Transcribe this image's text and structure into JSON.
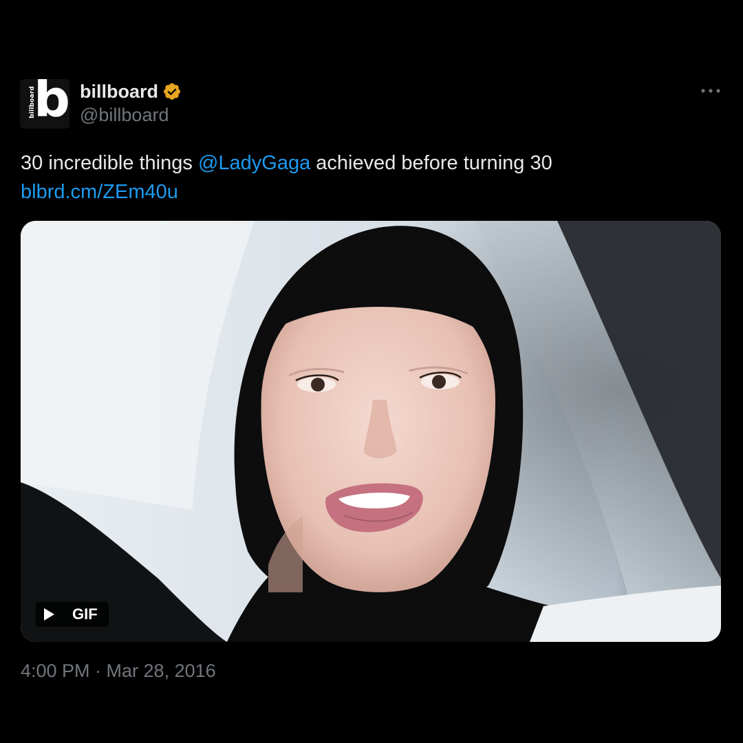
{
  "tweet": {
    "author": {
      "display_name": "billboard",
      "handle": "@billboard",
      "verified": true,
      "avatar_letter": "b",
      "avatar_wordmark": "billboard",
      "verified_color": "#e8a521"
    },
    "more_icon": "more-horizontal-icon",
    "text": {
      "prefix": "30 incredible things ",
      "mention": "@LadyGaga",
      "suffix": " achieved before turning 30",
      "link": "blbrd.cm/ZEm40u"
    },
    "media": {
      "type": "gif",
      "badge_label": "GIF",
      "badge_icon": "play-icon"
    },
    "timestamp": "4:00 PM · Mar 28, 2016"
  },
  "colors": {
    "background": "#000000",
    "text_primary": "#e7e9ea",
    "text_secondary": "#71767b",
    "link": "#1d9bf0"
  }
}
